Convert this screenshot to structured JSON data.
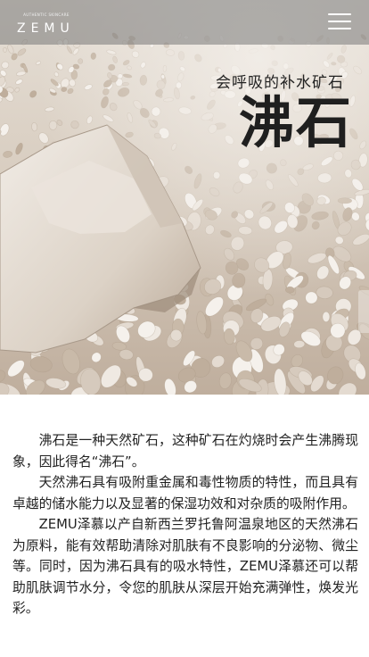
{
  "header": {
    "logo_tagline": "AUTHENTIC SKINCARE",
    "logo_word": "ZEMU",
    "menu_icon": "hamburger-menu-icon"
  },
  "hero": {
    "subtitle": "会呼吸的补水矿石",
    "title": "沸石",
    "image": "zeolite-stones-photo"
  },
  "content": {
    "paragraphs": [
      "沸石是一种天然矿石，这种矿石在灼烧时会产生沸腾现象，因此得名“沸石”。",
      "天然沸石具有吸附重金属和毒性物质的特性，而且具有卓越的储水能力以及显著的保湿功效和对杂质的吸附作用。",
      "ZEMU泽慕以产自新西兰罗托鲁阿温泉地区的天然沸石为原料，能有效帮助清除对肌肤有不良影响的分泌物、微尘等。同时，因为沸石具有的吸水特性，ZEMU泽慕还可以帮助肌肤调节水分，令您的肌肤从深层开始充满弹性，焕发光彩。"
    ]
  }
}
